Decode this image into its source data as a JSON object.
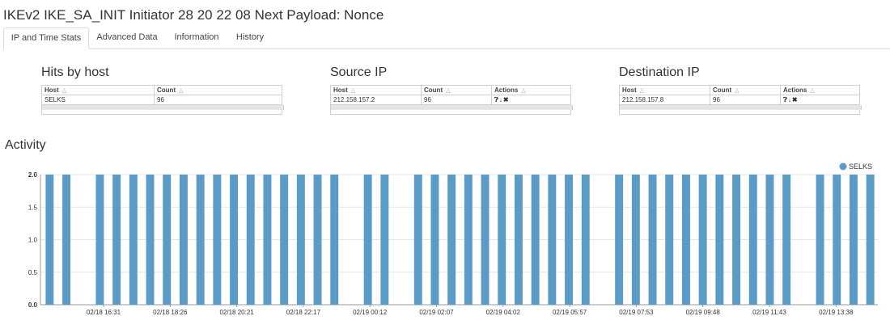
{
  "title": "IKEv2 IKE_SA_INIT Initiator 28 20 22 08 Next Payload: Nonce",
  "tabs": [
    {
      "label": "IP and Time Stats",
      "active": true
    },
    {
      "label": "Advanced Data",
      "active": false
    },
    {
      "label": "Information",
      "active": false
    },
    {
      "label": "History",
      "active": false
    }
  ],
  "hits_by_host": {
    "title": "Hits by host",
    "columns": [
      "Host",
      "Count"
    ],
    "rows": [
      [
        "SELKS",
        "96"
      ]
    ]
  },
  "source_ip": {
    "title": "Source IP",
    "columns": [
      "Host",
      "Count",
      "Actions"
    ],
    "rows": [
      [
        "212.158.157.2",
        "96"
      ]
    ]
  },
  "destination_ip": {
    "title": "Destination IP",
    "columns": [
      "Host",
      "Count",
      "Actions"
    ],
    "rows": [
      [
        "212.158.157.8",
        "96"
      ]
    ]
  },
  "icons": {
    "sort": "sort-triangle-icon",
    "actions": [
      "question-circle-icon",
      "arrow-down-icon",
      "close-icon"
    ]
  },
  "activity": {
    "title": "Activity"
  },
  "chart_data": {
    "type": "bar",
    "ylim": [
      0,
      2
    ],
    "yticks": [
      "0.0",
      "0.5",
      "1.0",
      "1.5",
      "2.0"
    ],
    "xtick_labels": [
      "02/18 16:31",
      "02/18 18:26",
      "02/18 20:21",
      "02/18 22:17",
      "02/19 00:12",
      "02/19 02:07",
      "02/19 04:02",
      "02/19 05:57",
      "02/19 07:53",
      "02/19 09:48",
      "02/19 11:43",
      "02/19 13:38"
    ],
    "series": [
      {
        "name": "SELKS",
        "color": "#5b9bc8",
        "values": [
          2,
          2,
          0,
          2,
          2,
          2,
          2,
          2,
          2,
          2,
          2,
          2,
          2,
          2,
          2,
          2,
          2,
          2,
          0,
          2,
          2,
          0,
          2,
          2,
          2,
          2,
          2,
          2,
          2,
          2,
          2,
          2,
          2,
          0,
          2,
          2,
          2,
          2,
          2,
          2,
          2,
          2,
          2,
          2,
          2,
          0,
          2,
          2,
          2,
          2
        ]
      }
    ],
    "legend": "top-right",
    "grid": true
  }
}
